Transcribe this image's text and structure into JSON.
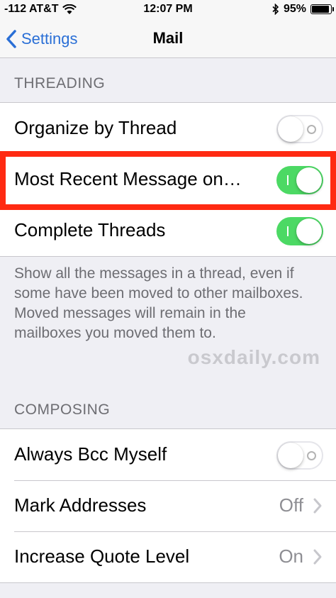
{
  "status_bar": {
    "carrier": "-112 AT&T",
    "time": "12:07 PM",
    "battery": "95%",
    "battery_level": 0.95
  },
  "nav": {
    "back_label": "Settings",
    "title": "Mail"
  },
  "threading": {
    "header": "THREADING",
    "rows": [
      {
        "label": "Organize by Thread",
        "toggle": "off"
      },
      {
        "label": "Most Recent Message on…",
        "toggle": "on"
      },
      {
        "label": "Complete Threads",
        "toggle": "on"
      }
    ],
    "footer": "Show all the messages in a thread, even if some have been moved to other mailboxes. Moved messages will remain in the mailboxes you moved them to."
  },
  "watermark": "osxdaily.com",
  "composing": {
    "header": "COMPOSING",
    "rows": [
      {
        "label": "Always Bcc Myself",
        "toggle": "off"
      },
      {
        "label": "Mark Addresses",
        "value": "Off"
      },
      {
        "label": "Increase Quote Level",
        "value": "On"
      }
    ]
  },
  "colors": {
    "accent": "#2a6fd6",
    "toggle_on": "#4cd964",
    "highlight": "#ff2a12"
  },
  "icons": [
    "signal-icon",
    "wifi-icon",
    "bluetooth-icon",
    "battery-icon",
    "back-chevron-icon",
    "chevron-right-icon"
  ]
}
